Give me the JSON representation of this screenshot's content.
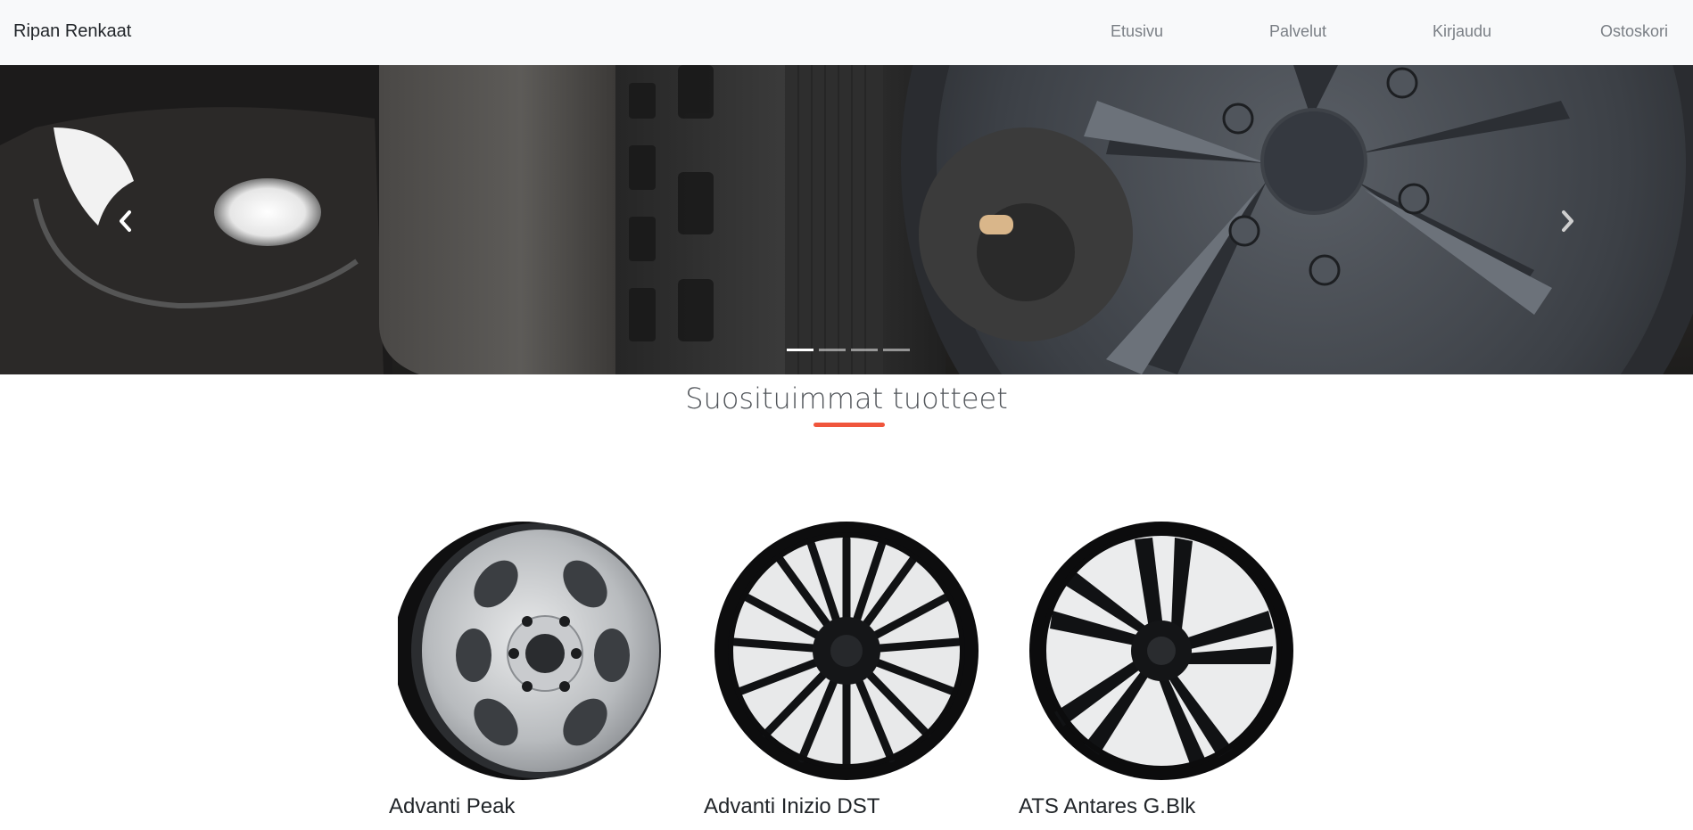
{
  "navbar": {
    "brand": "Ripan Renkaat",
    "links": [
      "Etusivu",
      "Palvelut",
      "Kirjaudu",
      "Ostoskori"
    ]
  },
  "carousel": {
    "slide_count": 4,
    "active_index": 0,
    "prev_icon": "chevron-left-icon",
    "next_icon": "chevron-right-icon"
  },
  "section": {
    "title": "Suosituimmat tuotteet",
    "accent_color": "#f0553c"
  },
  "products": [
    {
      "name": "Advanti Peak",
      "finish": "silver"
    },
    {
      "name": "Advanti Inizio DST",
      "finish": "black"
    },
    {
      "name": "ATS Antares G.Blk",
      "finish": "black"
    }
  ]
}
